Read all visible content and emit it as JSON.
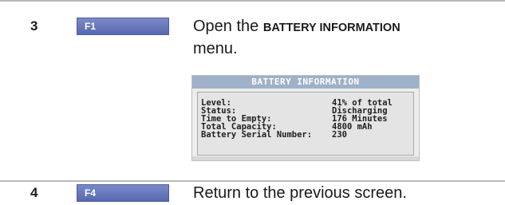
{
  "steps": [
    {
      "number": "3",
      "key_label": "F1",
      "instruction_prefix": "Open the ",
      "instruction_caps": "BATTERY INFORMATION",
      "instruction_suffix": "menu."
    },
    {
      "number": "4",
      "key_label": "F4",
      "instruction": "Return to the previous screen."
    }
  ],
  "screen": {
    "title": "BATTERY INFORMATION",
    "rows": [
      {
        "label": "Level:",
        "value": "41% of total"
      },
      {
        "label": "Status:",
        "value": "Discharging"
      },
      {
        "label": "Time to Empty:",
        "value": "176 Minutes"
      },
      {
        "label": "Total Capacity:",
        "value": "4800 mAh"
      },
      {
        "label": "Battery Serial Number:",
        "value": "230"
      }
    ]
  },
  "colors": {
    "key_fill": "#6a7abc",
    "screen_title_bar": "#9fb0c9",
    "divider": "#b8b8b8"
  }
}
